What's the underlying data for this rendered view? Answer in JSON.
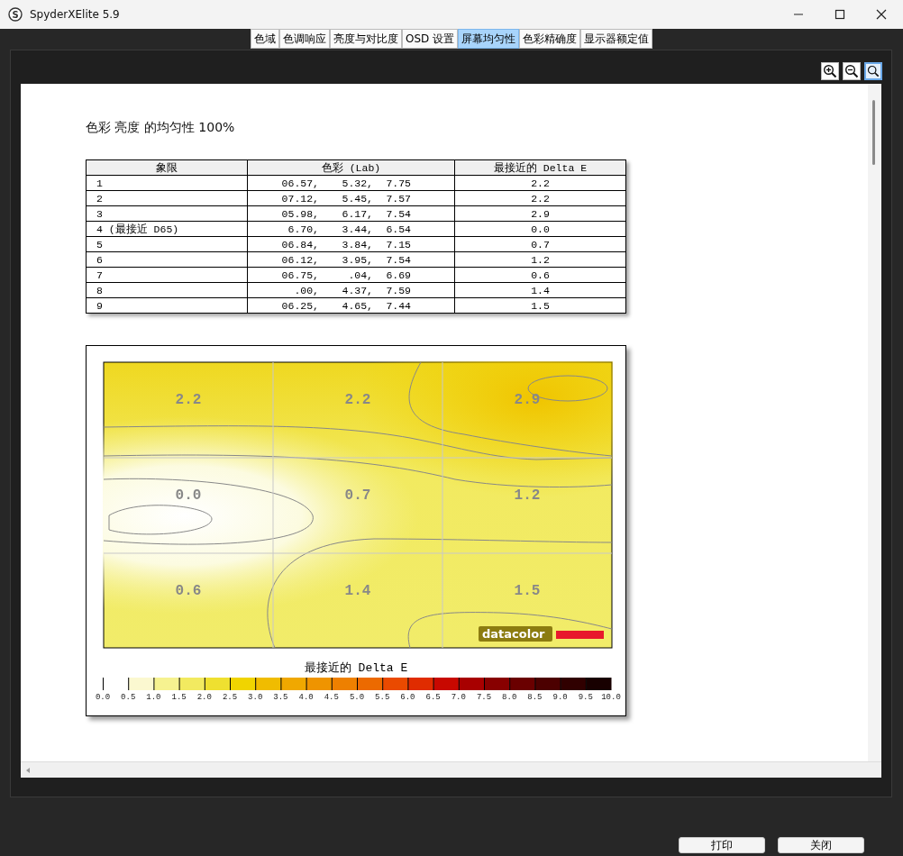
{
  "window": {
    "title": "SpyderXElite 5.9",
    "icon_letter": "S"
  },
  "tabs": [
    {
      "label": "色域",
      "selected": false
    },
    {
      "label": "色调响应",
      "selected": false
    },
    {
      "label": "亮度与对比度",
      "selected": false
    },
    {
      "label": "OSD 设置",
      "selected": false
    },
    {
      "label": "屏幕均匀性",
      "selected": true
    },
    {
      "label": "色彩精确度",
      "selected": false
    },
    {
      "label": "显示器额定值",
      "selected": false
    }
  ],
  "zoom_tools": [
    {
      "kind": "zoom_in",
      "selected": false
    },
    {
      "kind": "zoom_out",
      "selected": false
    },
    {
      "kind": "fit",
      "selected": true
    }
  ],
  "report": {
    "heading": "色彩 亮度 的均匀性 100%",
    "table": {
      "columns": [
        "象限",
        "色彩 (Lab)",
        "最接近的 Delta E"
      ],
      "rows": [
        {
          "quadrant": "1",
          "lab": [
            "06.57,",
            "5.32,",
            "7.75"
          ],
          "delta_e": "2.2"
        },
        {
          "quadrant": "2",
          "lab": [
            "07.12,",
            "5.45,",
            "7.57"
          ],
          "delta_e": "2.2"
        },
        {
          "quadrant": "3",
          "lab": [
            "05.98,",
            "6.17,",
            "7.54"
          ],
          "delta_e": "2.9"
        },
        {
          "quadrant": "4 (最接近 D65)",
          "lab": [
            "6.70,",
            "3.44,",
            "6.54"
          ],
          "delta_e": "0.0"
        },
        {
          "quadrant": "5",
          "lab": [
            "06.84,",
            "3.84,",
            "7.15"
          ],
          "delta_e": "0.7"
        },
        {
          "quadrant": "6",
          "lab": [
            "06.12,",
            "3.95,",
            "7.54"
          ],
          "delta_e": "1.2"
        },
        {
          "quadrant": "7",
          "lab": [
            "06.75,",
            ".04,",
            "6.69"
          ],
          "delta_e": "0.6"
        },
        {
          "quadrant": "8",
          "lab": [
            ".00,",
            "4.37,",
            "7.59"
          ],
          "delta_e": "1.4"
        },
        {
          "quadrant": "9",
          "lab": [
            "06.25,",
            "4.65,",
            "7.44"
          ],
          "delta_e": "1.5"
        }
      ]
    },
    "heatmap": {
      "cells": [
        "2.2",
        "2.2",
        "2.9",
        "0.0",
        "0.7",
        "1.2",
        "0.6",
        "1.4",
        "1.5"
      ],
      "logo": "datacolor",
      "legend": {
        "title": "最接近的 Delta E",
        "ticks": [
          "0.0",
          "0.5",
          "1.0",
          "1.5",
          "2.0",
          "2.5",
          "3.0",
          "3.5",
          "4.0",
          "4.5",
          "5.0",
          "5.5",
          "6.0",
          "6.5",
          "7.0",
          "7.5",
          "8.0",
          "8.5",
          "9.0",
          "9.5",
          "10.0"
        ]
      }
    }
  },
  "buttons": [
    "打印",
    "关闭"
  ]
}
